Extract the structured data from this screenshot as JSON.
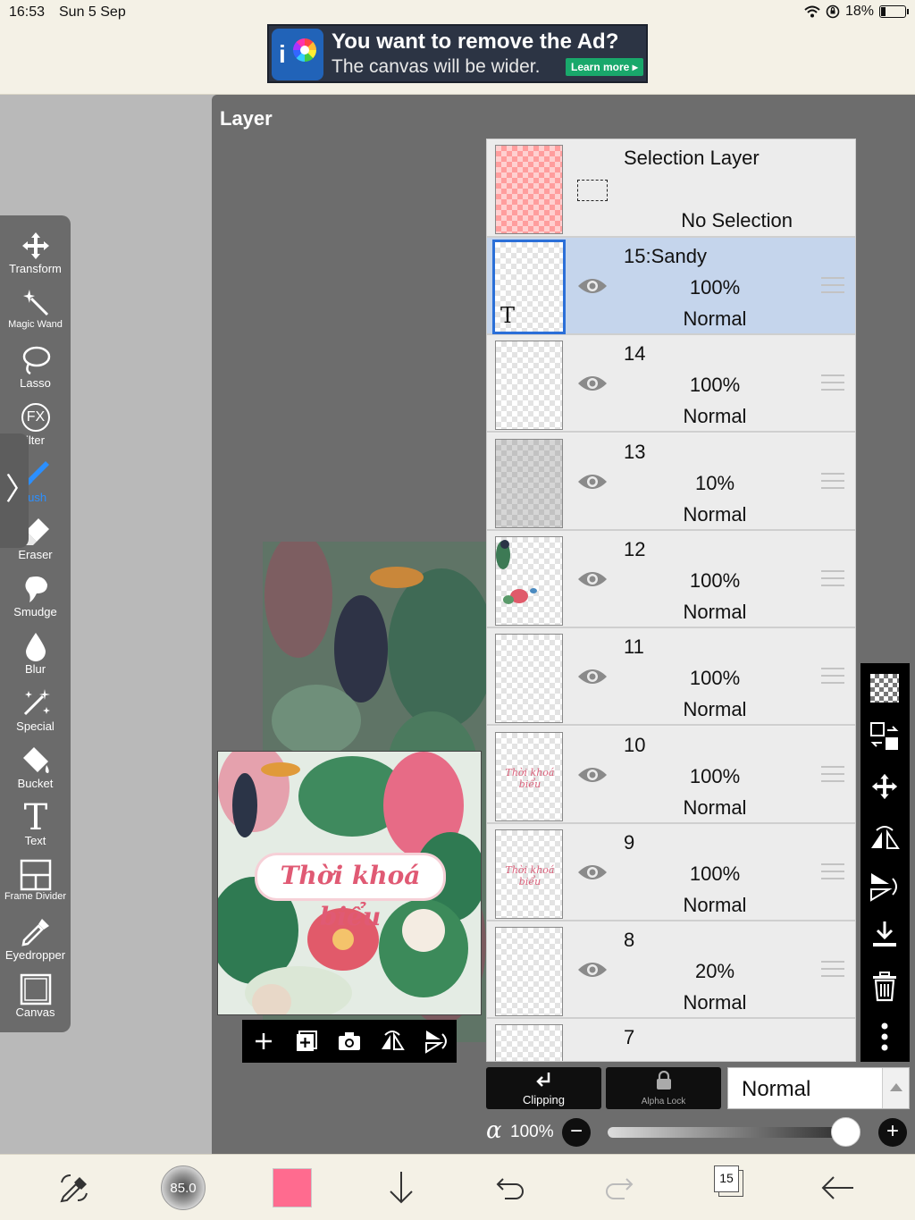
{
  "status_bar": {
    "time": "16:53",
    "date": "Sun 5 Sep",
    "battery": "18%"
  },
  "ad": {
    "title": "You want to remove the Ad?",
    "subtitle": "The canvas will be wider.",
    "learn_more": "Learn more ▸",
    "logo_text": "i"
  },
  "panel": {
    "title": "Layer"
  },
  "canvas": {
    "thumb_text": "Thời khoá biểu"
  },
  "tools": [
    {
      "label": "Transform",
      "icon": "move-arrows-icon"
    },
    {
      "label": "Magic Wand",
      "icon": "magic-wand-icon"
    },
    {
      "label": "Lasso",
      "icon": "lasso-icon"
    },
    {
      "label": "ilter",
      "icon": "fx-filter-icon",
      "icon_text": "FX"
    },
    {
      "label": "rush",
      "icon": "brush-icon"
    },
    {
      "label": "Eraser",
      "icon": "eraser-icon"
    },
    {
      "label": "Smudge",
      "icon": "smudge-icon"
    },
    {
      "label": "Blur",
      "icon": "blur-drop-icon"
    },
    {
      "label": "Special",
      "icon": "special-sparkle-icon"
    },
    {
      "label": "Bucket",
      "icon": "bucket-icon"
    },
    {
      "label": "Text",
      "icon": "text-icon",
      "icon_text": "T"
    },
    {
      "label": "Frame Divider",
      "icon": "frame-divider-icon"
    },
    {
      "label": "Eyedropper",
      "icon": "eyedropper-icon"
    },
    {
      "label": "Canvas",
      "icon": "canvas-icon"
    }
  ],
  "toolbar_handle": "〉",
  "selection_layer": {
    "title": "Selection Layer",
    "status": "No Selection"
  },
  "layers": [
    {
      "name": "15:Sandy",
      "opacity": "100%",
      "blend": "Normal",
      "selected": true,
      "thumb": "text"
    },
    {
      "name": "14",
      "opacity": "100%",
      "blend": "Normal",
      "thumb": "blank"
    },
    {
      "name": "13",
      "opacity": "10%",
      "blend": "Normal",
      "thumb": "grey"
    },
    {
      "name": "12",
      "opacity": "100%",
      "blend": "Normal",
      "thumb": "art"
    },
    {
      "name": "11",
      "opacity": "100%",
      "blend": "Normal",
      "thumb": "blank"
    },
    {
      "name": "10",
      "opacity": "100%",
      "blend": "Normal",
      "thumb": "script"
    },
    {
      "name": "9",
      "opacity": "100%",
      "blend": "Normal",
      "thumb": "script"
    },
    {
      "name": "8",
      "opacity": "20%",
      "blend": "Normal",
      "thumb": "blank"
    },
    {
      "name": "7",
      "opacity": "",
      "blend": "",
      "thumb": "blank"
    }
  ],
  "thumb_text_marker": "T",
  "thumb_script_text": "Thời khoá biểu",
  "controls": {
    "clipping_label": "Clipping",
    "alpha_lock_label": "Alpha Lock",
    "blend_mode": "Normal",
    "alpha_symbol": "α",
    "opacity_value": "100%",
    "minus": "−",
    "plus": "+",
    "opacity_fraction": 1.0
  },
  "bottom_bar": {
    "brush_size": "85.0",
    "color": "#ff6b8f",
    "layer_count": "15"
  },
  "colors": {
    "accent": "#2b8fff",
    "selected_row": "#c5d5ec",
    "panel": "#6d6d6d"
  }
}
